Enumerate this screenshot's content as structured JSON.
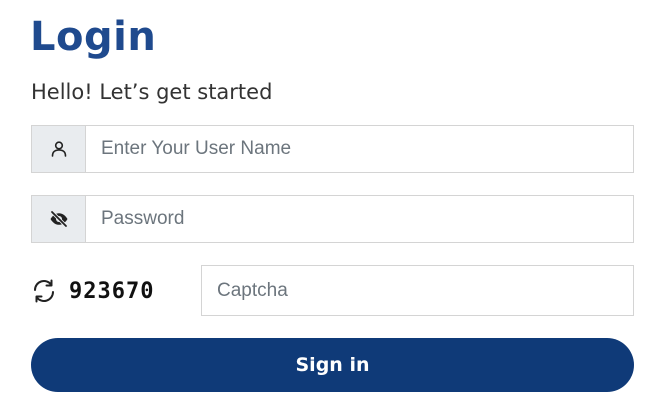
{
  "login": {
    "title": "Login",
    "subtitle": "Hello! Let’s get started"
  },
  "username": {
    "icon": "user-icon",
    "placeholder": "Enter Your User Name",
    "value": ""
  },
  "password": {
    "icon": "eye-slash-icon",
    "placeholder": "Password",
    "value": ""
  },
  "captcha": {
    "refresh_icon": "refresh-icon",
    "code": "923670",
    "placeholder": "Captcha",
    "value": ""
  },
  "submit": {
    "label": "Sign in"
  },
  "colors": {
    "title": "#1f4a8e",
    "button": "#0f3a78",
    "addon_bg": "#e9ecef",
    "border": "#d4d4d4"
  }
}
